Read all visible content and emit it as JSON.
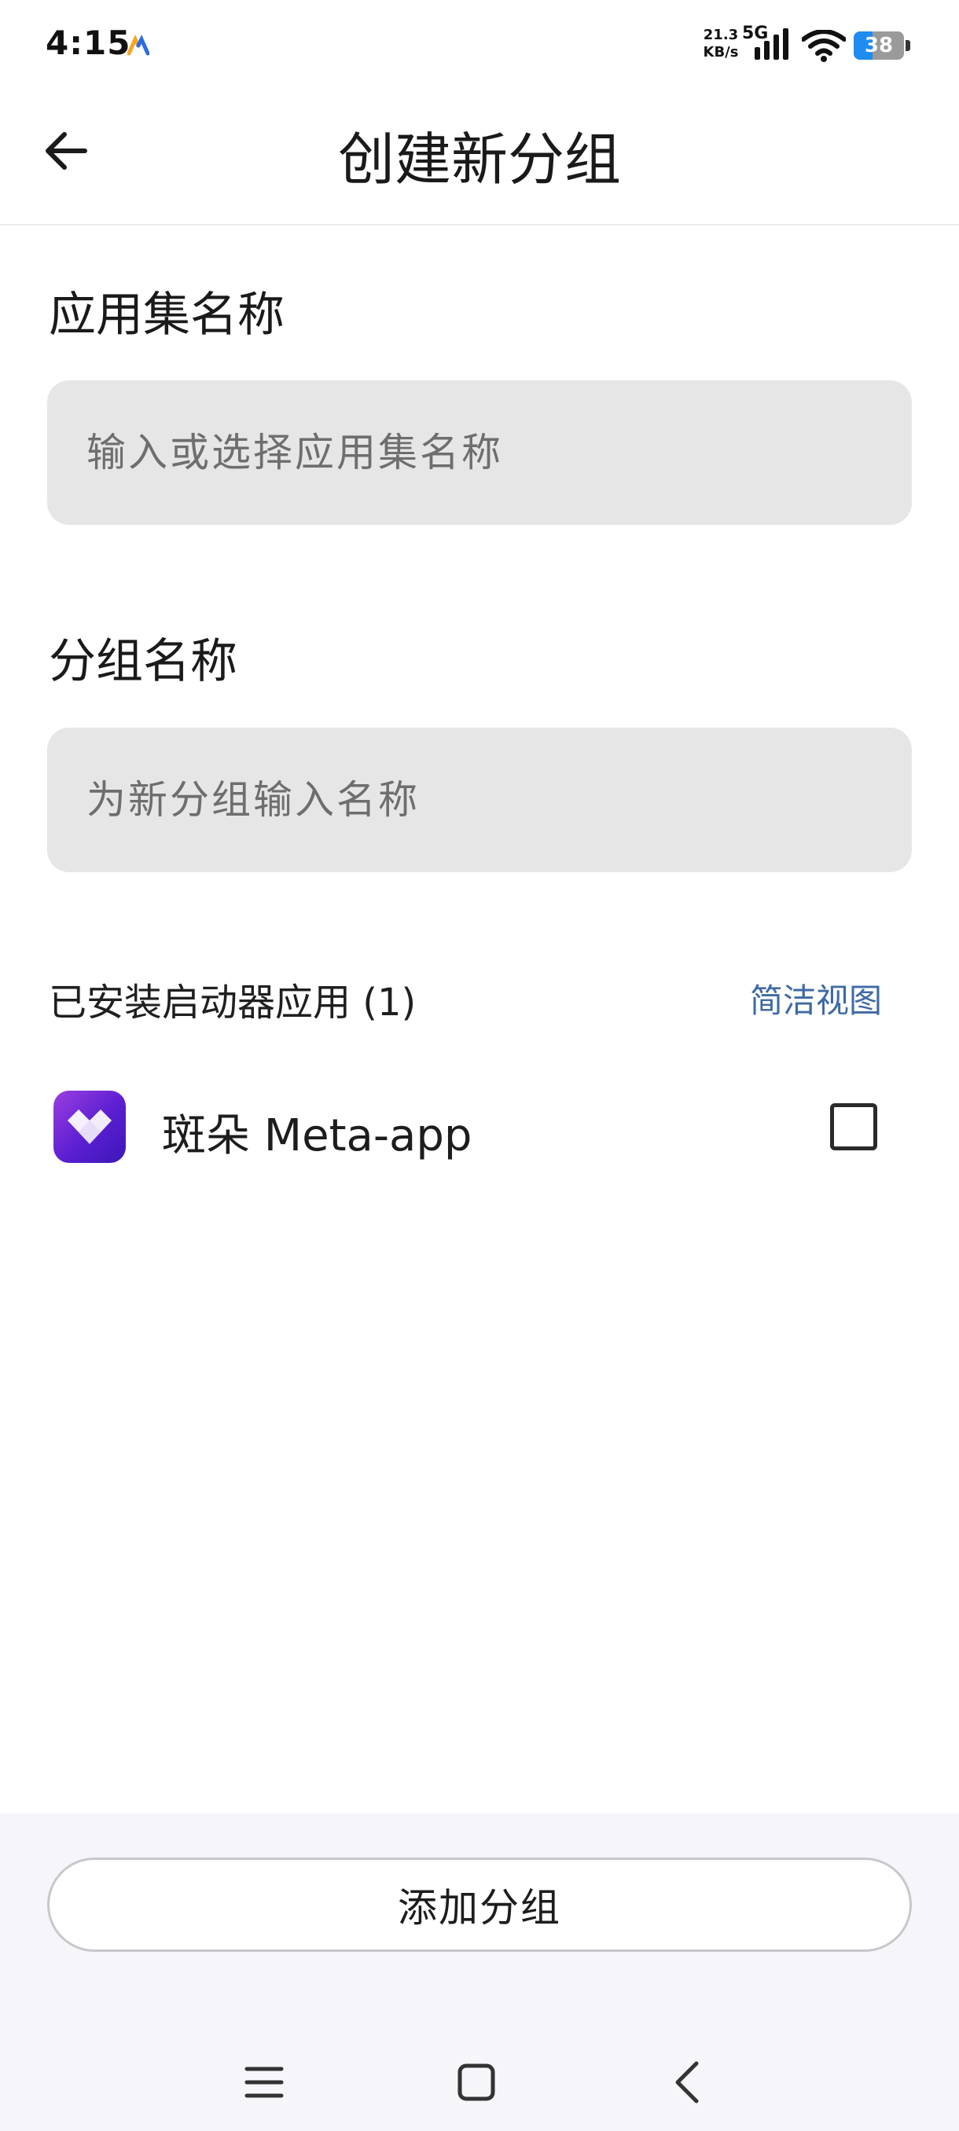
{
  "status_bar": {
    "time": "4:15",
    "net_speed_value": "21.3",
    "net_speed_unit": "KB/s",
    "network": "5G",
    "battery": "38"
  },
  "header": {
    "title": "创建新分组"
  },
  "app_set": {
    "label": "应用集名称",
    "placeholder": "输入或选择应用集名称",
    "value": ""
  },
  "group": {
    "label": "分组名称",
    "placeholder": "为新分组输入名称",
    "value": ""
  },
  "installed": {
    "label": "已安装启动器应用 (1)",
    "view_toggle": "简洁视图",
    "apps": [
      {
        "name": "斑朵 Meta-app",
        "checked": false
      }
    ]
  },
  "footer": {
    "add_button": "添加分组"
  },
  "colors": {
    "accent_link": "#3f6aa4",
    "input_bg": "#e6e6e6",
    "battery_fill": "#1e8cf0"
  },
  "icons": {
    "back": "arrow-left-icon",
    "app": "banduo-app-icon",
    "nav_menu": "menu-icon",
    "nav_home": "home-square-icon",
    "nav_back": "chevron-left-icon"
  }
}
